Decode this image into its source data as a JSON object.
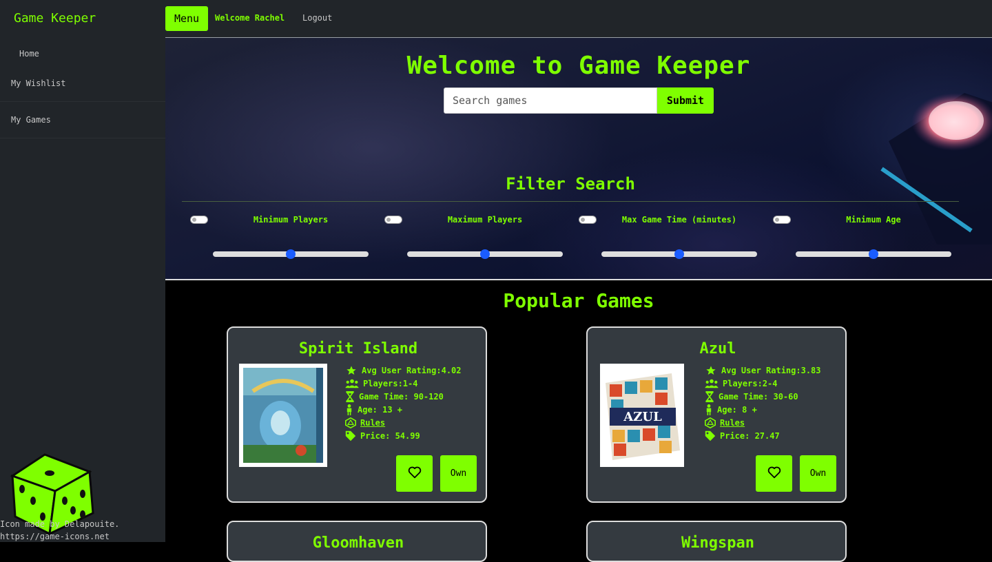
{
  "sidebar": {
    "brand": "Game Keeper",
    "home": "Home",
    "items": [
      {
        "label": "My Wishlist"
      },
      {
        "label": "My Games"
      }
    ],
    "credit_line1": "Icon made by Delapouite.",
    "credit_line2": "https://game-icons.net"
  },
  "topbar": {
    "menu_label": "Menu",
    "welcome": "Welcome Rachel",
    "logout": "Logout"
  },
  "hero": {
    "title": "Welcome to Game Keeper",
    "search_placeholder": "Search games",
    "submit_label": "Submit"
  },
  "filters": {
    "title": "Filter Search",
    "items": [
      {
        "label": "Minimum Players",
        "value": 0.5,
        "enabled": false
      },
      {
        "label": "Maximum Players",
        "value": 0.5,
        "enabled": false
      },
      {
        "label": "Max Game Time (minutes)",
        "value": 0.5,
        "enabled": false
      },
      {
        "label": "Minimum Age",
        "value": 0.5,
        "enabled": false
      }
    ]
  },
  "popular": {
    "title": "Popular Games",
    "games": [
      {
        "title": "Spirit Island",
        "rating": "Avg User Rating:4.02",
        "players": "Players:1-4",
        "time": "Game Time: 90-120",
        "age": "Age: 13 +",
        "rules": "Rules",
        "price": "Price: 54.99",
        "own_label": "Own"
      },
      {
        "title": "Azul",
        "rating": "Avg User Rating:3.83",
        "players": "Players:2-4",
        "time": "Game Time: 30-60",
        "age": "Age: 8 +",
        "rules": "Rules",
        "price": "Price: 27.47",
        "own_label": "Own"
      },
      {
        "title": "Gloomhaven"
      },
      {
        "title": "Wingspan"
      }
    ]
  },
  "colors": {
    "accent": "#7fff00",
    "sidebar": "#212529",
    "card": "#343a40",
    "slider_knob": "#1a5cff"
  }
}
